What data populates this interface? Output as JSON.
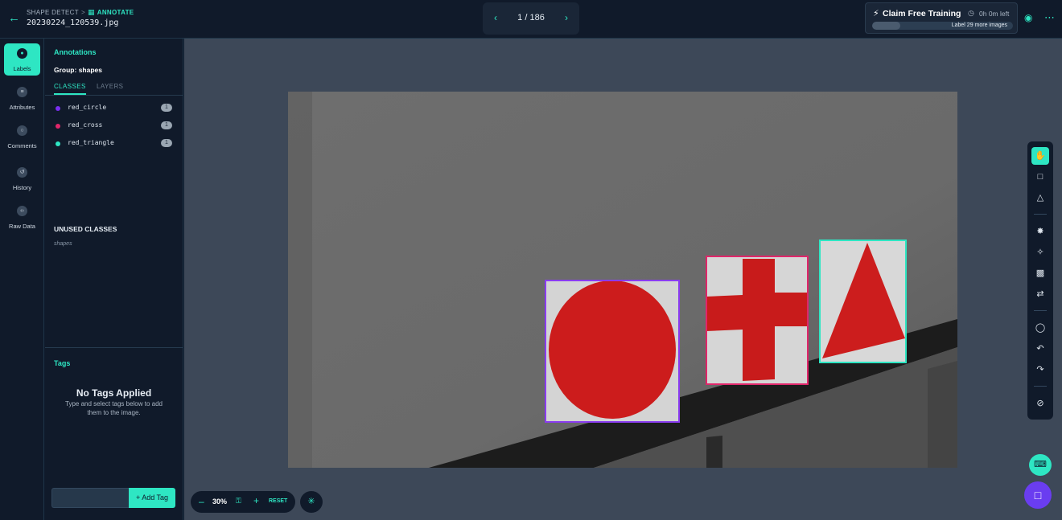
{
  "header": {
    "breadcrumb_project": "SHAPE DETECT",
    "breadcrumb_separator": ">",
    "breadcrumb_current": "ANNOTATE",
    "filename": "20230224_120539.jpg"
  },
  "pager": {
    "position": "1 / 186"
  },
  "claim": {
    "title": "Claim Free Training",
    "time_left": "0h 0m left",
    "progress_text": "Label 29 more images",
    "progress_fraction": 0.2
  },
  "rail": {
    "labels": "Labels",
    "attributes": "Attributes",
    "comments": "Comments",
    "history": "History",
    "raw_data": "Raw Data"
  },
  "panel": {
    "title": "Annotations",
    "group": "Group: shapes",
    "tab_classes": "CLASSES",
    "tab_layers": "LAYERS",
    "classes": [
      {
        "name": "red_circle",
        "count": "1",
        "color": "#7a2ff0"
      },
      {
        "name": "red_cross",
        "count": "1",
        "color": "#e0266a"
      },
      {
        "name": "red_triangle",
        "count": "1",
        "color": "#2ee6c3"
      }
    ],
    "unused_title": "UNUSED CLASSES",
    "unused_items": [
      "shapes"
    ],
    "tags_title": "Tags",
    "no_tags_title": "No Tags Applied",
    "no_tags_hint": "Type and select tags below to add them to the image.",
    "tag_input_placeholder": "",
    "add_tag_label": "+ Add Tag"
  },
  "zoom": {
    "percent": "30%",
    "reset_label": "RESET"
  },
  "colors": {
    "accent": "#2ee6c3",
    "circle_box": "#8a3cf0",
    "cross_box": "#e0266a",
    "triangle_box": "#2ee6c3",
    "shape_red": "#d11f1f"
  },
  "icons": {
    "toolbar": [
      "hand-icon",
      "bounding-box-icon",
      "polygon-icon",
      "smart-select-icon",
      "magic-wand-icon",
      "auto-box-icon",
      "convert-icon",
      "comment-icon",
      "undo-icon",
      "redo-icon",
      "hide-icon"
    ]
  }
}
